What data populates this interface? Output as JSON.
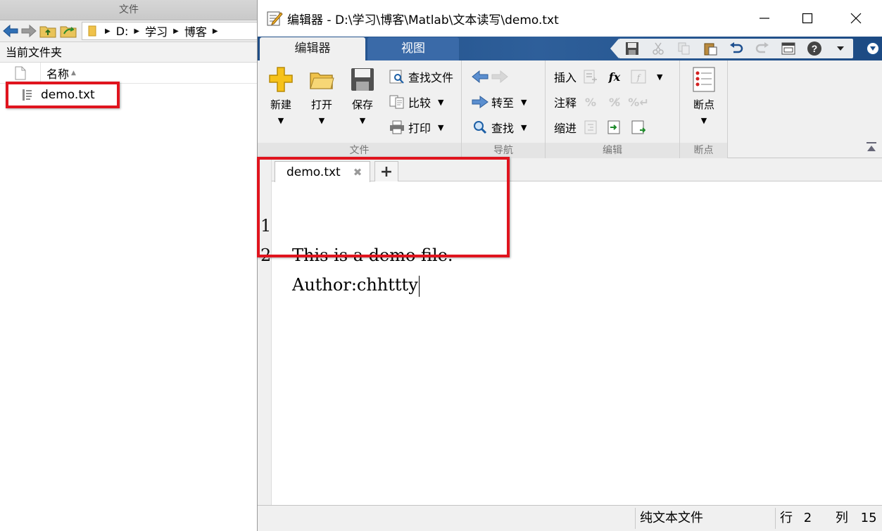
{
  "left_panel": {
    "title": "文件",
    "address": {
      "segments": [
        "D:",
        "学习",
        "博客"
      ]
    },
    "current_folder_label": "当前文件夹",
    "column_name": "名称",
    "files": [
      {
        "name": "demo.txt"
      }
    ]
  },
  "editor": {
    "title": "编辑器 - D:\\学习\\博客\\Matlab\\文本读写\\demo.txt",
    "tabs": [
      "编辑器",
      "视图"
    ],
    "groups": {
      "file": {
        "label": "文件",
        "new_label": "新建",
        "open_label": "打开",
        "save_label": "保存",
        "find_files_label": "查找文件",
        "compare_label": "比较",
        "print_label": "打印"
      },
      "navigate": {
        "label": "导航",
        "goto_label": "转至",
        "find_label": "查找"
      },
      "edit": {
        "label": "编辑",
        "insert_label": "插入",
        "comment_label": "注释",
        "indent_label": "缩进",
        "fx_label": "fx"
      },
      "breakpoints": {
        "label": "断点",
        "button_label": "断点"
      }
    },
    "document_tab": "demo.txt",
    "lines": [
      {
        "number": "1",
        "text": "This is a demo file."
      },
      {
        "number": "2",
        "text": "Author:chhttty"
      }
    ],
    "status": {
      "file_type": "纯文本文件",
      "row_label": "行",
      "row": "2",
      "col_label": "列",
      "col": "15"
    }
  },
  "colors": {
    "ribbon_blue": "#1f4d86",
    "highlight_red": "#e0141e"
  }
}
